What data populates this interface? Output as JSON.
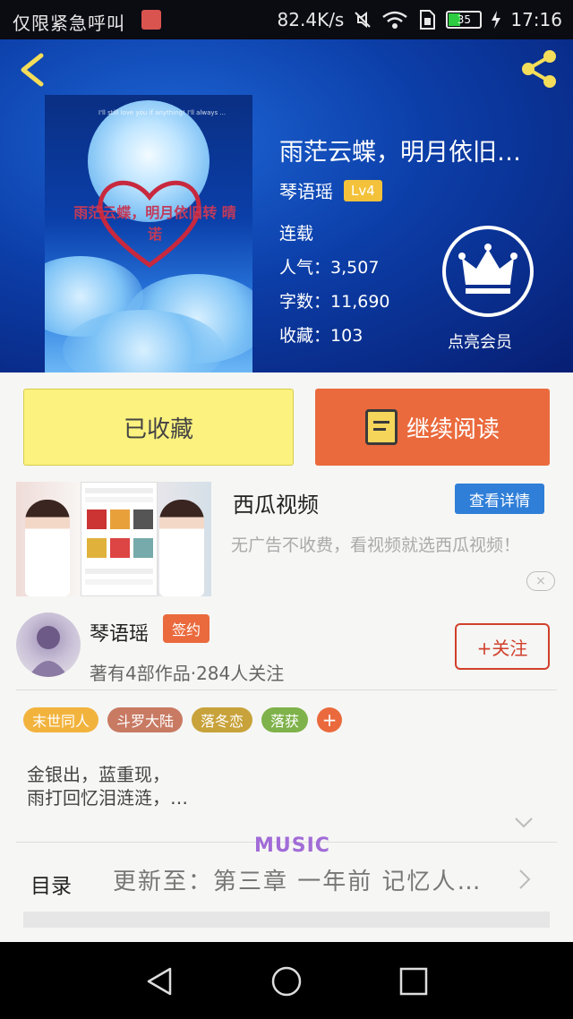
{
  "status_bar": {
    "emergency_text": "仅限紧急呼叫",
    "net_speed": "82.4K/s",
    "battery_level": "35",
    "time": "17:16"
  },
  "book": {
    "title": "雨茫云蝶，明月依旧…",
    "author": "琴语瑶",
    "level_badge": "Lv4",
    "status": "连载",
    "popularity_label": "人气：",
    "popularity_value": "3,507",
    "word_count_label": "字数：",
    "word_count_value": "11,690",
    "favorites_label": "收藏：",
    "favorites_value": "103",
    "cover_text": "雨茫云蝶，明月依旧转 晴诺",
    "cover_tiny_text": "I'll still love you if anything! I'll always ..."
  },
  "vip": {
    "label": "点亮会员"
  },
  "actions": {
    "collected_label": "已收藏",
    "continue_label": "继续阅读"
  },
  "ad": {
    "title": "西瓜视频",
    "detail_button": "查看详情",
    "description": "无广告不收费，看视频就选西瓜视频！",
    "close_label": "×"
  },
  "author_card": {
    "name": "琴语瑶",
    "signed_badge": "签约",
    "stats": "著有4部作品·284人关注",
    "follow_label": "+关注"
  },
  "tags": [
    {
      "label": "末世同人",
      "color": "#f2b33d"
    },
    {
      "label": "斗罗大陆",
      "color": "#c87a63"
    },
    {
      "label": "落冬恋",
      "color": "#c8a23a"
    },
    {
      "label": "落获",
      "color": "#7fb24a"
    }
  ],
  "tag_add_label": "+",
  "intro": {
    "line1": "金银出，蓝重现，",
    "line2": "雨打回忆泪涟涟，…"
  },
  "catalog": {
    "label": "目录",
    "latest": "更新至：第三章 一年前 记忆人…",
    "overlay_text": "MUSIC"
  },
  "colors": {
    "accent_orange": "#ea6a3d",
    "collected_yellow": "#fbf27f",
    "detail_blue": "#2f7fd8",
    "follow_red": "#d0402c"
  }
}
